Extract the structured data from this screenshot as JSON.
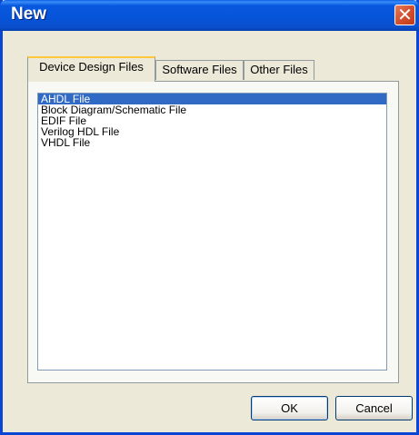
{
  "window": {
    "title": "New",
    "close_icon": "close-icon"
  },
  "tabs": [
    {
      "label": "Device Design Files",
      "active": true
    },
    {
      "label": "Software Files",
      "active": false
    },
    {
      "label": "Other Files",
      "active": false
    }
  ],
  "file_types": [
    {
      "label": "AHDL File",
      "selected": true
    },
    {
      "label": "Block Diagram/Schematic File",
      "selected": false
    },
    {
      "label": "EDIF File",
      "selected": false
    },
    {
      "label": "Verilog HDL File",
      "selected": false
    },
    {
      "label": "VHDL File",
      "selected": false
    }
  ],
  "buttons": {
    "ok_label": "OK",
    "cancel_label": "Cancel"
  },
  "colors": {
    "title_bar": "#0653D8",
    "selection": "#316AC5",
    "close_button": "#D3502E",
    "tab_highlight": "#FFC83C"
  }
}
